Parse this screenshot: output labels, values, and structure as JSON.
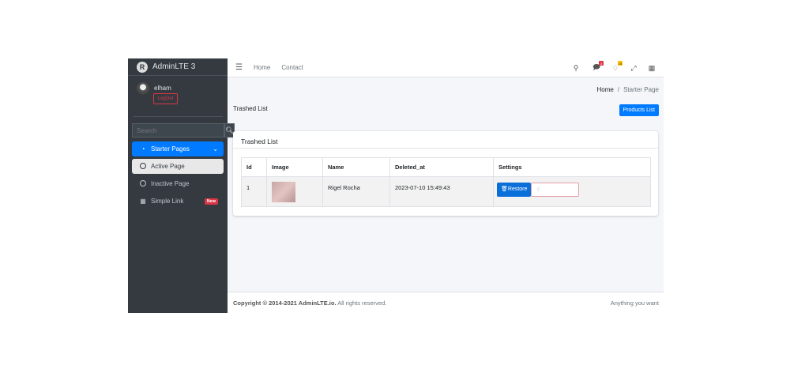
{
  "sidebar": {
    "brand": "AdminLTE 3",
    "logo_letter": "R",
    "user": "elham",
    "logout": "LogOut",
    "search_placeholder": "Search",
    "items": [
      {
        "label": "Starter Pages",
        "icon": "tachometer-icon"
      },
      {
        "label": "Active Page"
      },
      {
        "label": "Inactive Page"
      },
      {
        "label": "Simple Link",
        "badge": "New"
      }
    ]
  },
  "navbar": {
    "links": [
      "Home",
      "Contact"
    ],
    "messages_count": "3",
    "notifications_count": "15"
  },
  "breadcrumb": {
    "home": "Home",
    "sep": "/",
    "current": "Starter Page"
  },
  "page": {
    "title": "Trashed List",
    "products_button": "Products List"
  },
  "card": {
    "title": "Trashed List",
    "columns": [
      "Id",
      "Image",
      "Name",
      "Deleted_at",
      "Settings"
    ],
    "rows": [
      {
        "id": "1",
        "name": "Rigel Rocha",
        "deleted_at": "2023-07-10 15:49:43",
        "restore": "Restore"
      }
    ]
  },
  "footer": {
    "copyright": "Copyright © 2014-2021 AdminLTE.io.",
    "rights": "All rights reserved.",
    "right": "Anything you want"
  },
  "colors": {
    "primary": "#007bff",
    "sidebar": "#343a40",
    "danger": "#dc3545"
  }
}
